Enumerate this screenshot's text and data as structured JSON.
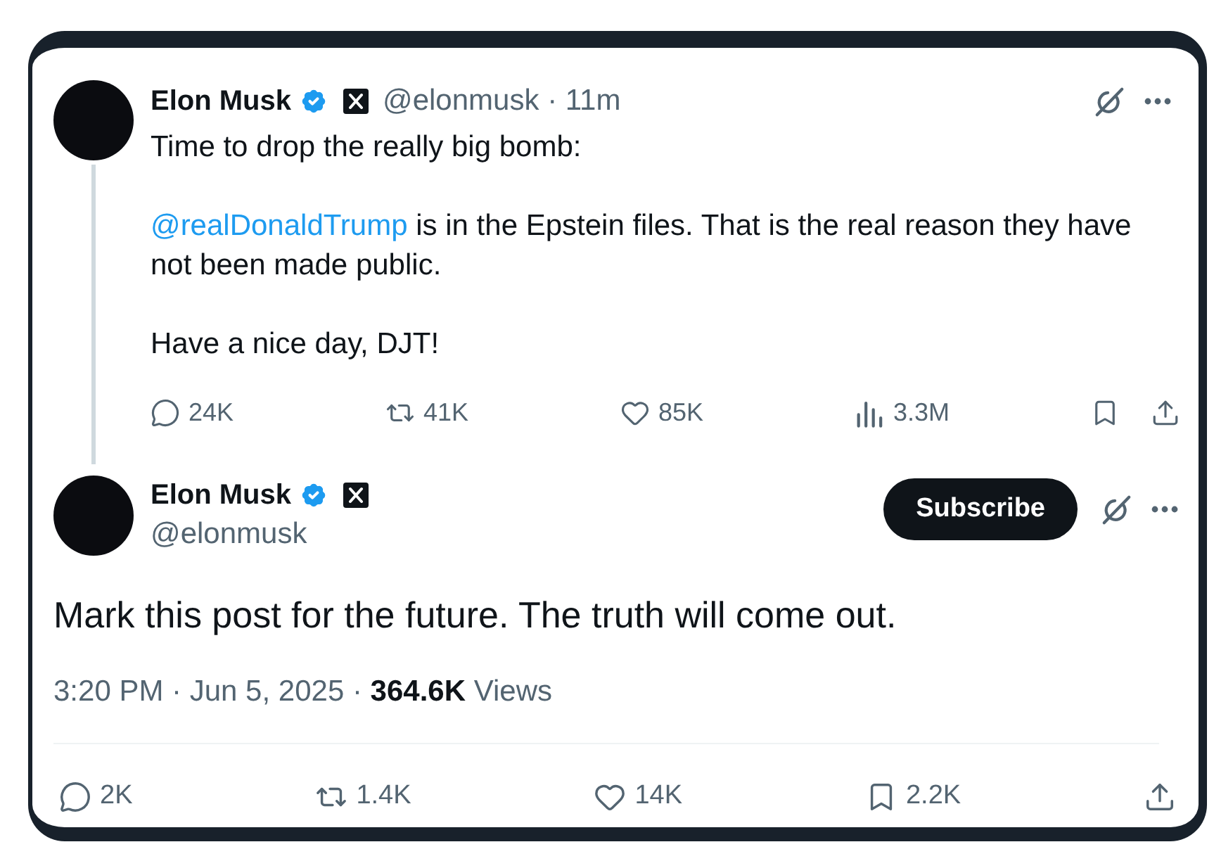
{
  "posts": [
    {
      "kind": "thread",
      "author": {
        "name": "Elon Musk",
        "handle": "@elonmusk",
        "verified": true,
        "affiliate_badge": true
      },
      "separator": "·",
      "time": "11m",
      "paragraphs": [
        {
          "text": "Time to drop the really big bomb:"
        },
        {
          "mention": "@realDonaldTrump",
          "text": "is in the Epstein files. That is the real reason they have not been made public."
        },
        {
          "text": "Have a nice day, DJT!"
        }
      ],
      "actions": [
        {
          "kind": "reply",
          "count": "24K"
        },
        {
          "kind": "repost",
          "count": "41K"
        },
        {
          "kind": "like",
          "count": "85K"
        },
        {
          "kind": "views",
          "count": "3.3M"
        },
        {
          "kind": "bookmark"
        },
        {
          "kind": "share"
        }
      ]
    },
    {
      "kind": "focused",
      "author": {
        "name": "Elon Musk",
        "handle": "@elonmusk",
        "verified": true,
        "affiliate_badge": true
      },
      "subscribe_label": "Subscribe",
      "text": "Mark this post for the future. The truth will come out.",
      "timestamp": "3:20 PM · Jun 5, 2025 · **364.6K** Views",
      "actions": [
        {
          "kind": "reply",
          "count": "2K"
        },
        {
          "kind": "repost",
          "count": "1.4K"
        },
        {
          "kind": "like",
          "count": "14K"
        },
        {
          "kind": "bookmark",
          "count": "2.2K"
        },
        {
          "kind": "share"
        }
      ]
    }
  ]
}
